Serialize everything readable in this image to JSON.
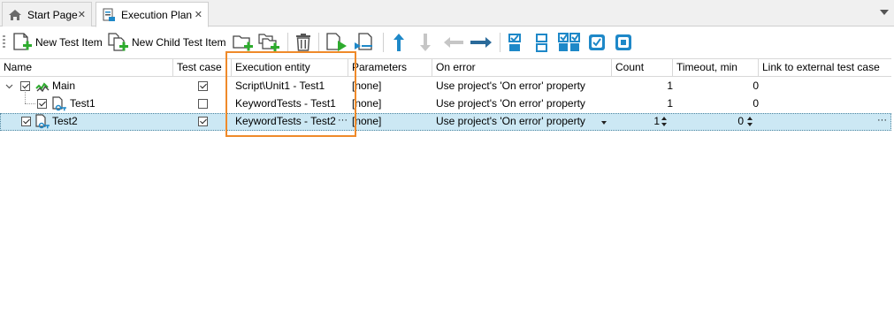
{
  "tabs": [
    {
      "label": "Start Page",
      "icon": "home-icon",
      "active": false
    },
    {
      "label": "Execution Plan",
      "icon": "execution-plan-icon",
      "active": true
    }
  ],
  "toolbar": {
    "new_test_item": "New Test Item",
    "new_child_test_item": "New Child Test Item",
    "icons": [
      "new-group-icon",
      "new-child-group-icon",
      "delete-icon",
      "run-icon",
      "run-selected-icon",
      "move-up-icon",
      "move-down-icon",
      "move-left-icon",
      "move-right-icon",
      "check-icon",
      "uncheck-all-icon",
      "check-all-icon",
      "check-selected-icon",
      "uncheck-selected-icon"
    ]
  },
  "columns": [
    "Name",
    "Test case",
    "Execution entity",
    "Parameters",
    "On error",
    "Count",
    "Timeout, min",
    "Link to external test case"
  ],
  "rows": [
    {
      "name": "Main",
      "level": 0,
      "expanded": true,
      "checked": true,
      "test_case": true,
      "entity": "Script\\Unit1 - Test1",
      "params": "[none]",
      "on_error": "Use project's 'On error' property",
      "count": "1",
      "timeout": "0",
      "link": "",
      "selected": false
    },
    {
      "name": "Test1",
      "level": 1,
      "checked": true,
      "test_case": false,
      "entity": "KeywordTests - Test1",
      "params": "[none]",
      "on_error": "Use project's 'On error' property",
      "count": "1",
      "timeout": "0",
      "link": "",
      "selected": false
    },
    {
      "name": "Test2",
      "level": 0,
      "checked": true,
      "test_case": true,
      "entity": "KeywordTests - Test2",
      "params": "[none]",
      "on_error": "Use project's 'On error' property",
      "count": "1",
      "timeout": "0",
      "link": "",
      "selected": true
    }
  ],
  "colors": {
    "accent": "#ef8a2a",
    "selection": "#cce8f4",
    "icon_blue": "#1e88c8",
    "icon_green": "#2dab2d"
  }
}
